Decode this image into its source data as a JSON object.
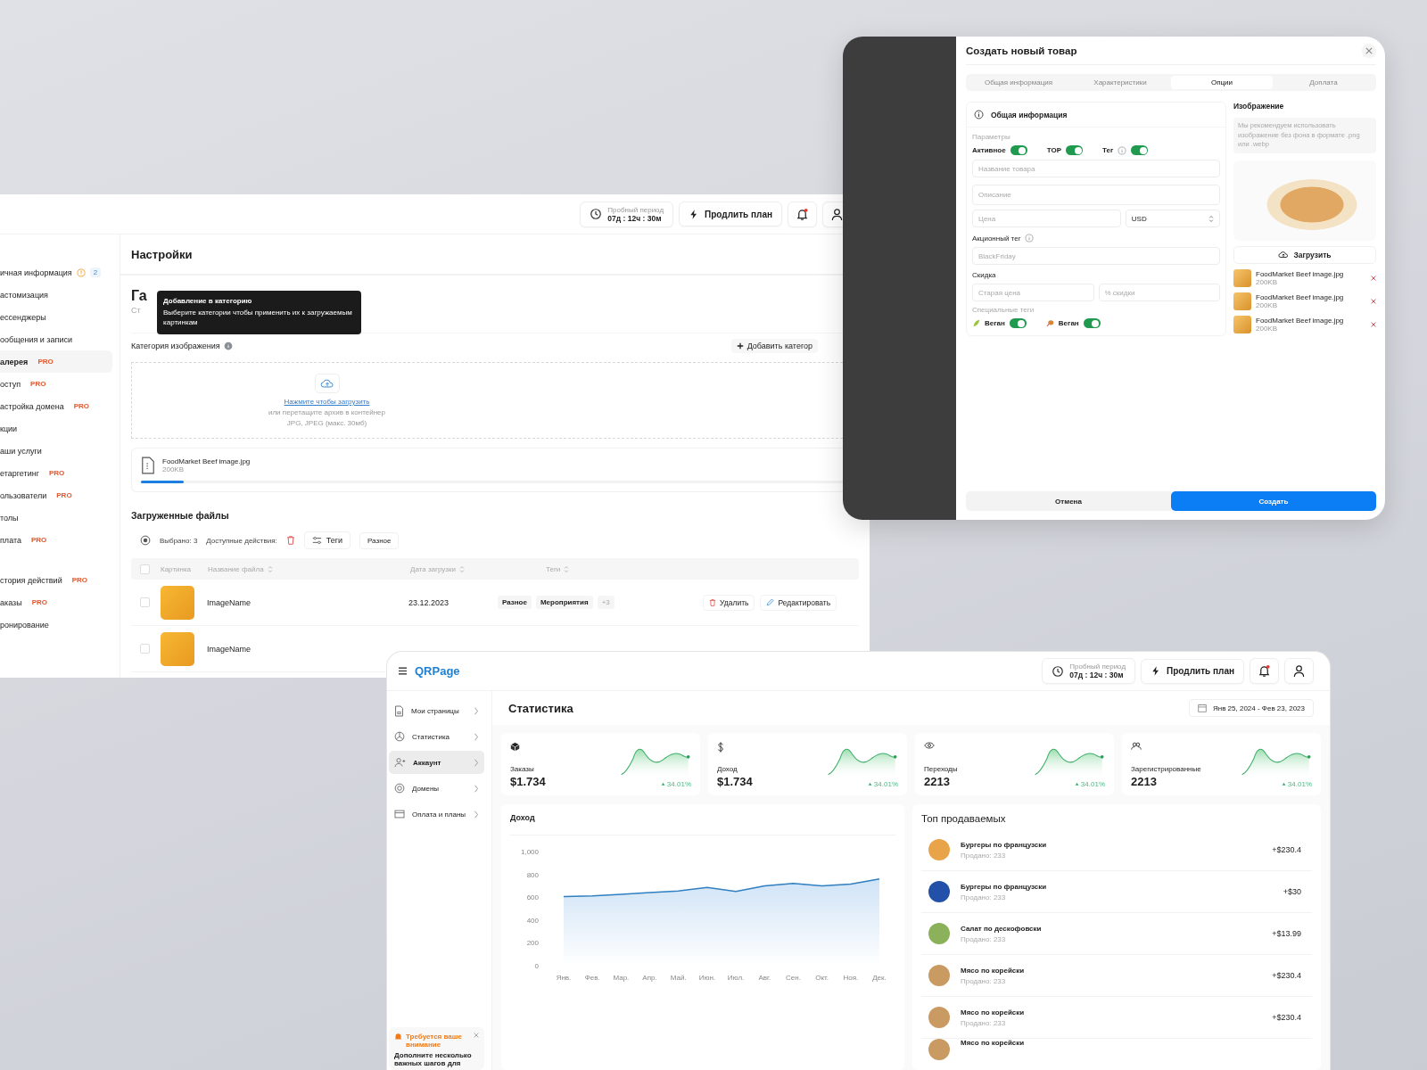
{
  "settings": {
    "header": {
      "trial_label": "Пробный период",
      "trial_time": "07д : 12ч : 30м",
      "extend": "Продлить план"
    },
    "sidebar_groups": [
      {
        "items": [
          {
            "label": "ичная информация",
            "warning": true,
            "count": "2",
            "selected": false
          },
          {
            "label": "астомизация",
            "selected": false
          },
          {
            "label": "ессенджеры",
            "selected": false
          },
          {
            "label": "ообщения и записи",
            "selected": false
          },
          {
            "label": "алерея",
            "badge": "PRO",
            "selected": true
          },
          {
            "label": "оступ",
            "badge": "PRO",
            "selected": false
          },
          {
            "label": "астройка домена",
            "badge": "PRO",
            "selected": false
          },
          {
            "label": "кции",
            "selected": false
          },
          {
            "label": "аши услуги",
            "selected": false
          },
          {
            "label": "етаргетинг",
            "badge": "PRO",
            "selected": false
          },
          {
            "label": "ользователи",
            "badge": "PRO",
            "selected": false
          },
          {
            "label": "толы",
            "selected": false
          },
          {
            "label": "плата",
            "badge": "PRO",
            "selected": false
          }
        ]
      },
      {
        "items": [
          {
            "label": "стория действий",
            "badge": "PRO",
            "selected": false
          },
          {
            "label": "аказы",
            "badge": "PRO",
            "selected": false
          },
          {
            "label": "ронирование",
            "selected": false
          }
        ]
      }
    ],
    "title": "Настройки",
    "section_title": "Га",
    "section_subtitle": "Ст",
    "tooltip": {
      "title": "Добавление в категорию",
      "text": "Выберите категории чтобы применить их к загружаемым картинкам"
    },
    "category_label": "Категория изображения",
    "add_category": "Добавить категор",
    "dropzone": {
      "link": "Нажмите чтобы загрузить",
      "hint": "или перетащите архив в контейнер",
      "formats": "JPG, JPEG (макс. 30мб)"
    },
    "uploading": {
      "name": "FoodMarket Beef image.jpg",
      "size": "200KB",
      "level": 0.06
    },
    "files_title": "Загруженные файлы",
    "toolbar": {
      "selected": "Выбрано: 3",
      "actions": "Доступные действия:",
      "tags": "Теги",
      "misc": "Разное"
    },
    "table": {
      "all_checked": false,
      "columns": [
        {
          "label": "Картинка",
          "sortable": false
        },
        {
          "label": "Название файла",
          "sortable": true
        },
        {
          "label": "Дата загрузки",
          "sortable": true
        },
        {
          "label": "Теги",
          "sortable": true
        }
      ],
      "rows": [
        {
          "checked": false,
          "name": "ImageName",
          "date": "23.12.2023",
          "tags": [
            "Разное",
            "Мероприятия"
          ],
          "more": "+3",
          "delete": "Удалить",
          "edit": "Редактировать"
        },
        {
          "checked": false,
          "name": "ImageName"
        }
      ]
    }
  },
  "modal": {
    "title": "Создать новый товар",
    "tabs": [
      {
        "label": "Общая информация",
        "selected": false
      },
      {
        "label": "Характеристики",
        "selected": false
      },
      {
        "label": "Опции",
        "selected": true
      },
      {
        "label": "Доплата",
        "selected": false
      }
    ],
    "section": "Общая информация",
    "params_label": "Параметры",
    "toggles": [
      {
        "label": "Активное",
        "info": false,
        "on": true
      },
      {
        "label": "TOP",
        "info": false,
        "on": true
      },
      {
        "label": "Тег",
        "info": true,
        "on": true
      }
    ],
    "name_placeholder": "Название товара",
    "description_placeholder": "Описание",
    "price_placeholder": "Цена",
    "currency": "USD",
    "promo_label": "Акционный тег",
    "promo_placeholder": "BlackFriday",
    "discount_label": "Скидка",
    "old_price_placeholder": "Старая цена",
    "percent_placeholder": "% скидки",
    "special_label": "Специальные теги",
    "special_tags": [
      {
        "kind": "leaf",
        "label": "Веган",
        "on": true
      },
      {
        "kind": "drumstick",
        "label": "Веган",
        "on": true
      }
    ],
    "image_title": "Изображение",
    "image_hint": "Мы рекомендуем использовать изображение без фона в формате .png или .webp",
    "upload": "Загрузить",
    "files": [
      {
        "name": "FoodMarket Beef image.jpg",
        "size": "200KB"
      },
      {
        "name": "FoodMarket Beef image.jpg",
        "size": "200KB"
      },
      {
        "name": "FoodMarket Beef image.jpg",
        "size": "200KB"
      }
    ],
    "cancel": "Отмена",
    "create": "Создать"
  },
  "dashboard": {
    "logo": "QRPage",
    "trial_label": "Пробный период",
    "trial_time": "07д : 12ч : 30м",
    "extend": "Продлить план",
    "nav": [
      {
        "kind": "page",
        "label": "Мои страницы",
        "selected": false
      },
      {
        "kind": "pie",
        "label": "Статистика",
        "selected": false
      },
      {
        "kind": "user",
        "label": "Аккаунт",
        "selected": true
      },
      {
        "kind": "globe",
        "label": "Домены",
        "selected": false
      },
      {
        "kind": "card",
        "label": "Оплата и планы",
        "selected": false
      }
    ],
    "alert": {
      "title": "Требуется ваше внимание",
      "text": "Дополните несколько важных шагов для"
    },
    "title": "Статистика",
    "date_range": "Янв 25, 2024 - Фев 23, 2023",
    "stats": [
      {
        "kind": "box",
        "label": "Заказы",
        "value": "$1.734",
        "change": "34.01%"
      },
      {
        "kind": "dollar",
        "label": "Доход",
        "value": "$1.734",
        "change": "34.01%"
      },
      {
        "kind": "eye",
        "label": "Переходы",
        "value": "2213",
        "change": "34.01%"
      },
      {
        "kind": "users",
        "label": "Зарегистрированные",
        "value": "2213",
        "change": "34.01%"
      }
    ],
    "revenue": {
      "chart_data": {
        "type": "area",
        "title": "Доход",
        "categories": [
          "Янв.",
          "Фев.",
          "Мар.",
          "Апр.",
          "Май.",
          "Июн.",
          "Июл.",
          "Авг.",
          "Сен.",
          "Окт.",
          "Ноя.",
          "Дек."
        ],
        "series": [
          {
            "color": "#2f7fc1",
            "values": [
              605,
              612,
              625,
              640,
              655,
              685,
              650,
              700,
              720,
              700,
              715,
              760
            ]
          }
        ],
        "ylim": [
          0,
          1000
        ],
        "yticks": [
          0,
          200,
          400,
          600,
          800,
          {
            "value": 1000,
            "label": "1,000"
          }
        ]
      }
    },
    "top": {
      "title": "Топ продаваемых",
      "items": [
        {
          "kind": "combo",
          "name": "Бургеры по французски",
          "sold": "Продано: 233",
          "amount": "+$230.4"
        },
        {
          "kind": "can",
          "name": "Бургеры по французски",
          "sold": "Продано: 233",
          "amount": "+$30"
        },
        {
          "kind": "salad",
          "name": "Салат по дескофовски",
          "sold": "Продано: 233",
          "amount": "+$13.99"
        },
        {
          "kind": "meat",
          "name": "Мясо по корейски",
          "sold": "Продано: 233",
          "amount": "+$230.4"
        },
        {
          "kind": "meat",
          "name": "Мясо по корейски",
          "sold": "Продано: 233",
          "amount": "+$230.4"
        },
        {
          "kind": "meat",
          "name": "Мясо по корейски"
        }
      ]
    }
  }
}
